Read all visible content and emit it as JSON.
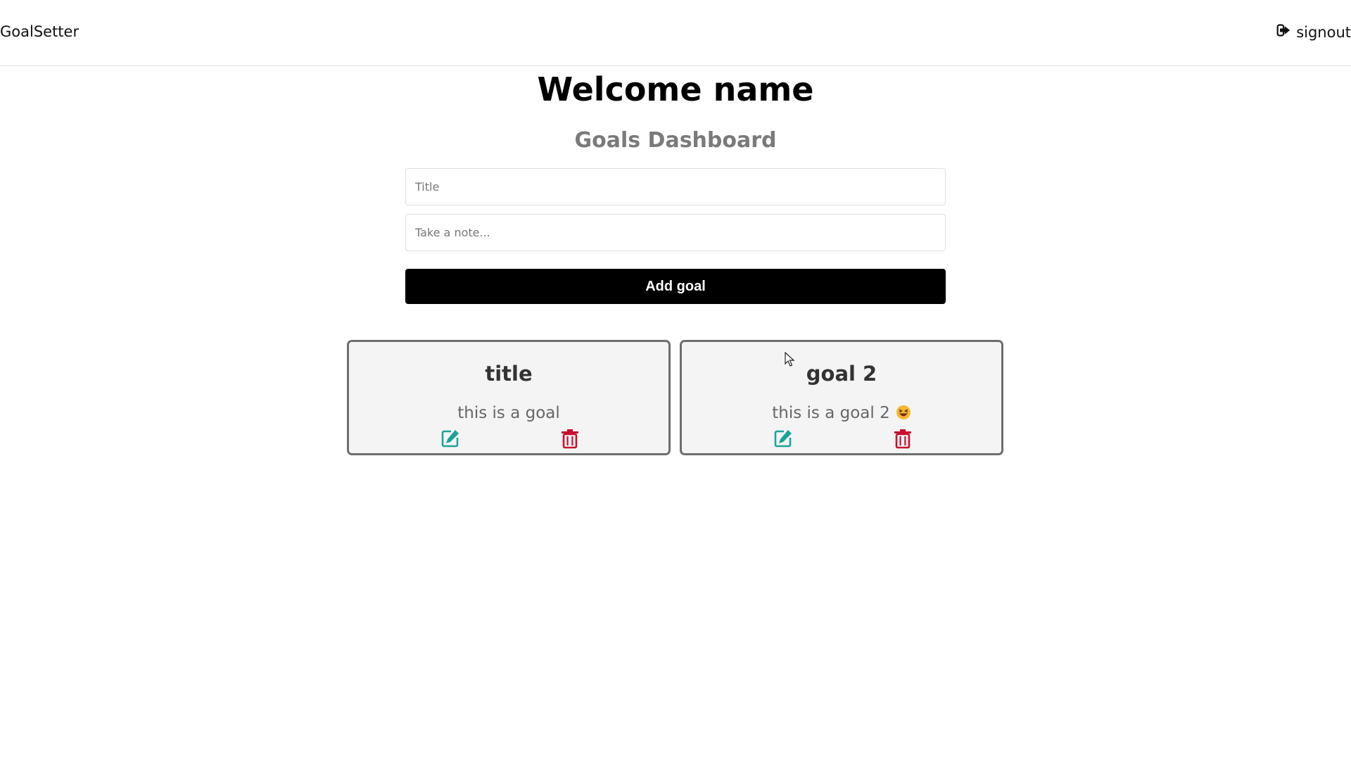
{
  "app": {
    "brand": "GoalSetter",
    "signout_label": "signout"
  },
  "main": {
    "welcome": "Welcome name",
    "dashboard_title": "Goals Dashboard",
    "title_placeholder": "Title",
    "note_placeholder": "Take a note...",
    "add_button": "Add goal"
  },
  "goals": [
    {
      "title": "title",
      "note": "this is a goal",
      "emoji": ""
    },
    {
      "title": "goal 2",
      "note": "this is a goal 2",
      "emoji": "grinning-squinting-face"
    }
  ],
  "colors": {
    "edit": "#1aa39a",
    "delete": "#c8102e",
    "button_bg": "#000000",
    "subtitle": "#7a7a7a",
    "card_border": "#6e6e6e",
    "card_bg": "#f4f4f4"
  },
  "icons": {
    "signout": "sign-out-icon",
    "edit": "edit-icon",
    "delete": "trash-icon"
  }
}
